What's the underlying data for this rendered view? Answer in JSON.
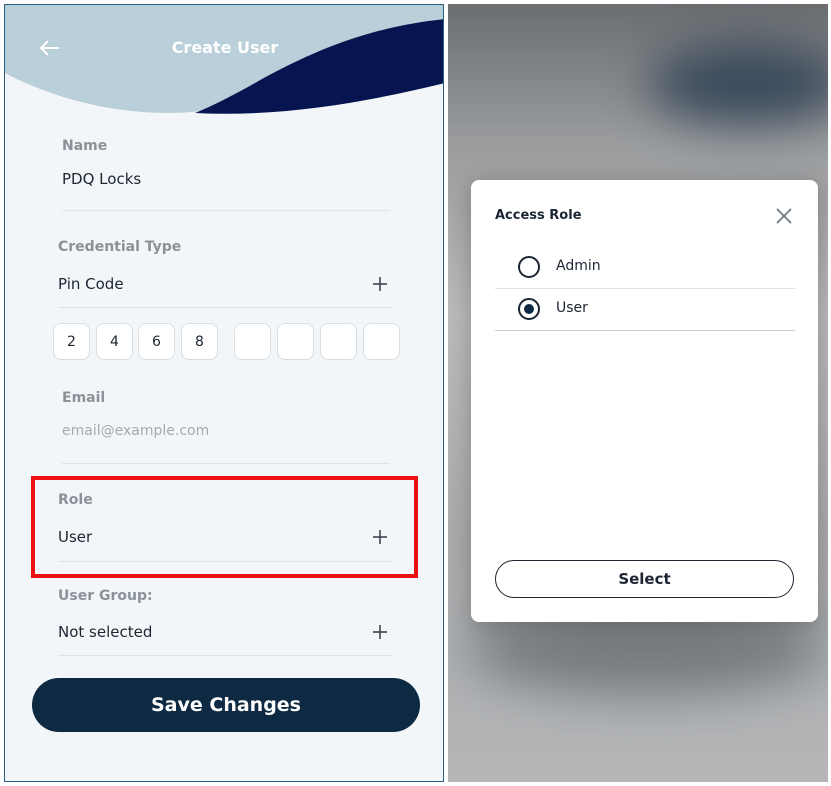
{
  "colors": {
    "wave_light": "#b9cfd9",
    "wave_dark": "#06154f",
    "panel_bg": "#f2f6f8",
    "primary_button": "#0e2a42",
    "highlight": "#ee0f13",
    "panel_border": "#2a5d82"
  },
  "create_user": {
    "header": {
      "title": "Create User",
      "back_icon": "arrow-left-icon"
    },
    "name": {
      "label": "Name",
      "value": "PDQ Locks"
    },
    "credential_type": {
      "label": "Credential Type",
      "value": "Pin Code",
      "expand_icon": "plus-icon"
    },
    "pin_digits": [
      "2",
      "4",
      "6",
      "8",
      "",
      "",
      "",
      ""
    ],
    "email": {
      "label": "Email",
      "placeholder": "email@example.com"
    },
    "role": {
      "label": "Role",
      "value": "User",
      "expand_icon": "plus-icon"
    },
    "user_group": {
      "label": "User Group:",
      "value": "Not selected",
      "expand_icon": "plus-icon"
    },
    "save_label": "Save Changes"
  },
  "access_role_modal": {
    "title": "Access Role",
    "close_icon": "close-icon",
    "options": [
      {
        "label": "Admin",
        "selected": false
      },
      {
        "label": "User",
        "selected": true
      }
    ],
    "select_label": "Select"
  }
}
